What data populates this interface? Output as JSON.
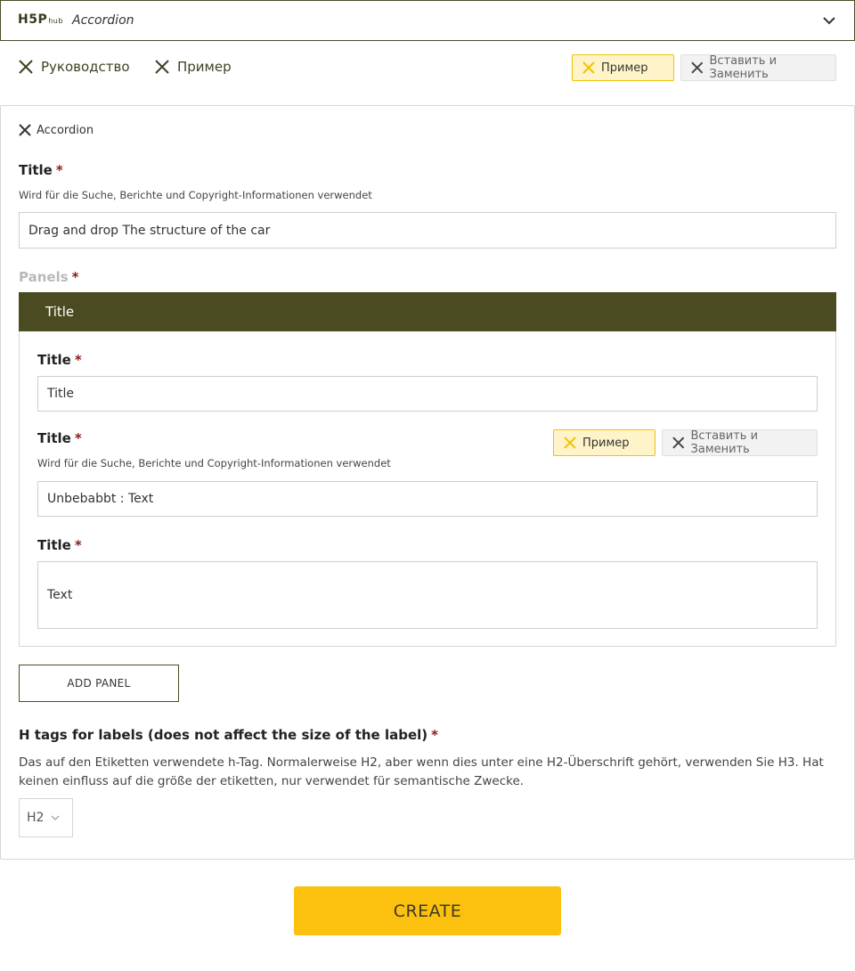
{
  "hub": {
    "logo_main": "H5P",
    "logo_sub": "hub",
    "content_type": "Accordion"
  },
  "tabs": {
    "guide": "Руководство",
    "example": "Пример"
  },
  "toolbar": {
    "example_label": "Пример",
    "paste_label": "Вставить и Заменить"
  },
  "form": {
    "accordion_tag": "Accordion",
    "title_label": "Title",
    "required_mark": "*",
    "title_desc": "Wird für die Suche, Berichte und Copyright-Informationen verwendet",
    "title_value": "Drag and drop The structure of the car",
    "panels_label": "Panels",
    "panel": {
      "header": "Title",
      "field1_label": "Title",
      "field1_value": "Title",
      "field2_label": "Title",
      "field2_desc": "Wird für die Suche, Berichte und Copyright-Informationen verwendet",
      "field2_value": "Unbebabbt : Text",
      "field2_example": "Пример",
      "field2_paste": "Вставить и Заменить",
      "field3_label": "Title",
      "field3_value": "Text"
    },
    "add_panel": "ADD PANEL",
    "htags_label": "H tags for labels (does not affect the size of the label)",
    "htags_desc": "Das auf den Etiketten verwendete h-Tag. Normalerweise H2, aber wenn dies unter eine H2-Überschrift gehört, verwenden Sie H3. Hat keinen einfluss auf die größe der etiketten, nur verwendet für semantische Zwecke.",
    "htags_value": "H2"
  },
  "create_label": "CREATE",
  "colors": {
    "brand_dark": "#4b4b22",
    "accent_yellow": "#fcc10f",
    "required_red": "#8b1a1a"
  }
}
